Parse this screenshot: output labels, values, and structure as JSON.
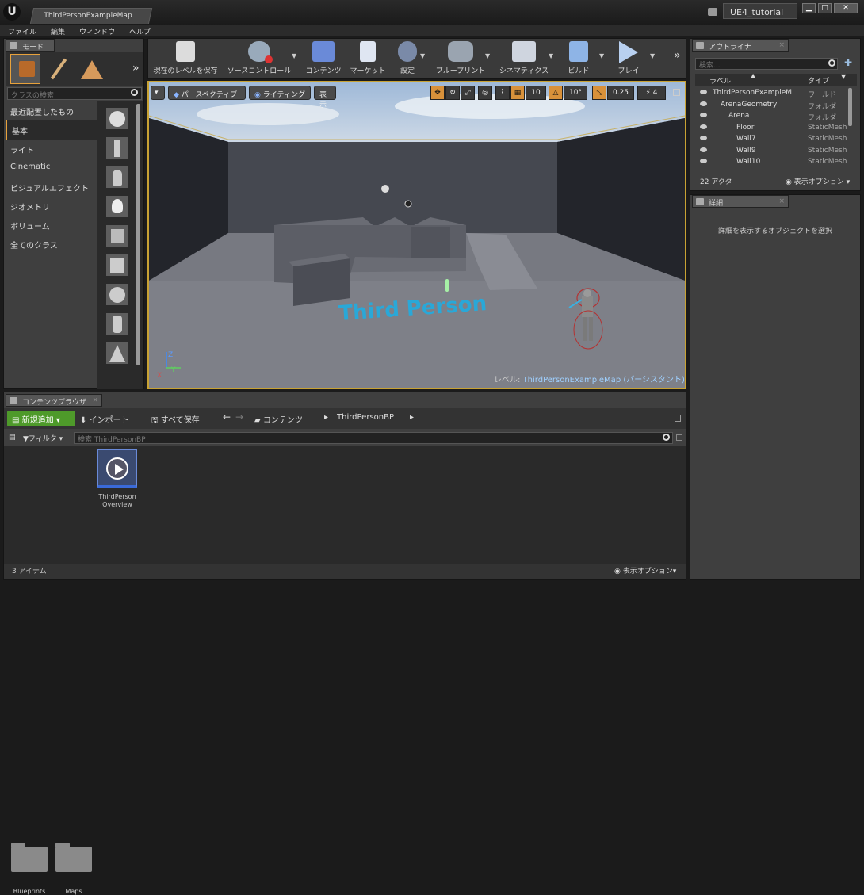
{
  "window": {
    "doc_tab": "ThirdPersonExampleMap",
    "project": "UE4_tutorial"
  },
  "menu": [
    "ファイル",
    "編集",
    "ウィンドウ",
    "ヘルプ"
  ],
  "modes": {
    "tab": "モード",
    "search_placeholder": "クラスの検索",
    "categories": [
      "最近配置したもの",
      "基本",
      "ライト",
      "Cinematic",
      "ビジュアルエフェクト",
      "ジオメトリ",
      "ボリューム",
      "全てのクラス"
    ]
  },
  "toolbar": [
    {
      "label": "現在のレベルを保存",
      "icon": "save-icon"
    },
    {
      "label": "ソースコントロール",
      "icon": "source-control-icon"
    },
    {
      "label": "コンテンツ",
      "icon": "content-icon"
    },
    {
      "label": "マーケット",
      "icon": "marketplace-icon"
    },
    {
      "label": "設定",
      "icon": "settings-icon"
    },
    {
      "label": "ブループリント",
      "icon": "blueprint-icon"
    },
    {
      "label": "シネマティクス",
      "icon": "cinematics-icon"
    },
    {
      "label": "ビルド",
      "icon": "build-icon"
    },
    {
      "label": "プレイ",
      "icon": "play-icon"
    }
  ],
  "viewport": {
    "perspective": "パースペクティブ",
    "lighting": "ライティング",
    "show": "表示",
    "grid_snap": "10",
    "rot_snap": "10°",
    "scale_snap": "0.25",
    "cam_speed": "4",
    "floor_text": "Third Person",
    "level_label": "レベル:",
    "level_name": "ThirdPersonExampleMap (パーシスタント)",
    "axis_x": "X",
    "axis_y": "Y",
    "axis_z": "Z"
  },
  "outliner": {
    "tab": "アウトライナ",
    "search_placeholder": "検索...",
    "col_label": "ラベル",
    "col_type": "タイプ",
    "rows": [
      {
        "label": "ThirdPersonExampleM",
        "type": "ワールド",
        "indent": 0
      },
      {
        "label": "ArenaGeometry",
        "type": "フォルダ",
        "indent": 1
      },
      {
        "label": "Arena",
        "type": "フォルダ",
        "indent": 2
      },
      {
        "label": "Floor",
        "type": "StaticMeshA",
        "indent": 3
      },
      {
        "label": "Wall7",
        "type": "StaticMeshA",
        "indent": 3
      },
      {
        "label": "Wall9",
        "type": "StaticMeshA",
        "indent": 3
      },
      {
        "label": "Wall10",
        "type": "StaticMeshA",
        "indent": 3
      }
    ],
    "count": "22 アクタ",
    "view_options": "表示オプション"
  },
  "details": {
    "tab": "詳細",
    "empty_text": "詳細を表示するオブジェクトを選択"
  },
  "content_browser": {
    "tab": "コンテンツブラウザ",
    "add_new": "新規追加",
    "import": "インポート",
    "save_all": "すべて保存",
    "path": [
      "コンテンツ",
      "ThirdPersonBP"
    ],
    "filter": "フィルタ",
    "search_placeholder": "検索 ThirdPersonBP",
    "items": [
      {
        "name": "Blueprints",
        "kind": "folder"
      },
      {
        "name": "Maps",
        "kind": "folder"
      },
      {
        "name1": "ThirdPerson",
        "name2": "Overview",
        "kind": "asset"
      }
    ],
    "count": "3 アイテム",
    "view_options": "表示オプション"
  },
  "colors": {
    "accent_orange": "#e8a23c",
    "selection_blue": "#2e5aa8",
    "add_green": "#4e9a2a",
    "floor_text": "#29a8d8"
  }
}
